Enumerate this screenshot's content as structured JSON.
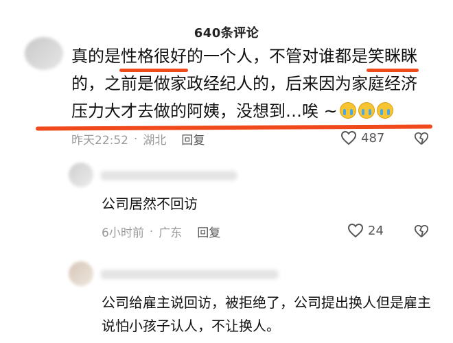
{
  "header": {
    "title": "640条评论"
  },
  "comment": {
    "segments_line1": [
      "真的是",
      "性格很好",
      "的一个人，不管对谁都是",
      "笑眯眯"
    ],
    "line2": "的，之前是做家政经纪人的，后来因为家庭经济",
    "line3": "压力大才去做的阿姨，没想到…唉 ~",
    "emoji": "loudly-crying-face",
    "time": "昨天22:52",
    "separator": "·",
    "location": "湖北",
    "reply_label": "回复",
    "likes": "487",
    "underline_color": "#f04a1c"
  },
  "replies": [
    {
      "text": "公司居然不回访",
      "time": "6小时前",
      "separator": "·",
      "location": "广东",
      "reply_label": "回复",
      "likes": "24"
    },
    {
      "text": "公司给雇主说回访，被拒绝了，公司提出换人但是雇主说怕小孩子认人，不让换人。"
    }
  ]
}
